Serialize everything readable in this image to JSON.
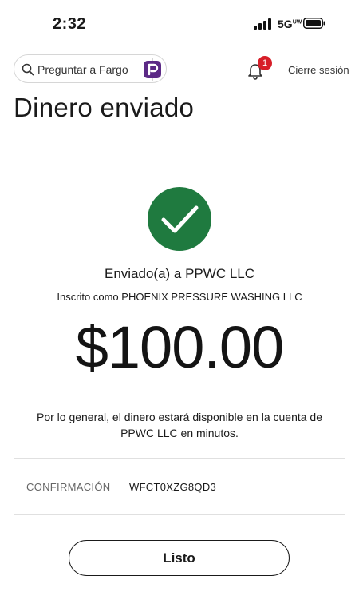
{
  "status_bar": {
    "time": "2:32",
    "network": "5G",
    "network_suffix": "UW",
    "icons": [
      "signal-icon",
      "battery-icon"
    ]
  },
  "header": {
    "search": {
      "label": "Preguntar a Fargo",
      "icon": "search-icon",
      "assistant_icon": "fargo-icon"
    },
    "notifications": {
      "icon": "bell-icon",
      "count": "1"
    },
    "sign_out_label": "Cierre sesión",
    "title": "Dinero enviado"
  },
  "confirmation": {
    "success_icon": "check-circle-icon",
    "sent_to": "Enviado(a) a PPWC LLC",
    "enrolled_as": "Inscrito como PHOENIX PRESSURE WASHING LLC",
    "amount": "$100.00",
    "availability_line1": "Por lo general, el dinero estará disponible en la cuenta de",
    "availability_line2": "PPWC LLC en minutos.",
    "confirmation_label": "CONFIRMACIÓN",
    "confirmation_number": "WFCT0XZG8QD3",
    "done_label": "Listo"
  },
  "colors": {
    "success_green": "#1f7a3f",
    "badge_red": "#d71e28",
    "fargo_purple": "#5c2a86",
    "text": "#1a1a1a",
    "rule": "#e0e0e0"
  }
}
